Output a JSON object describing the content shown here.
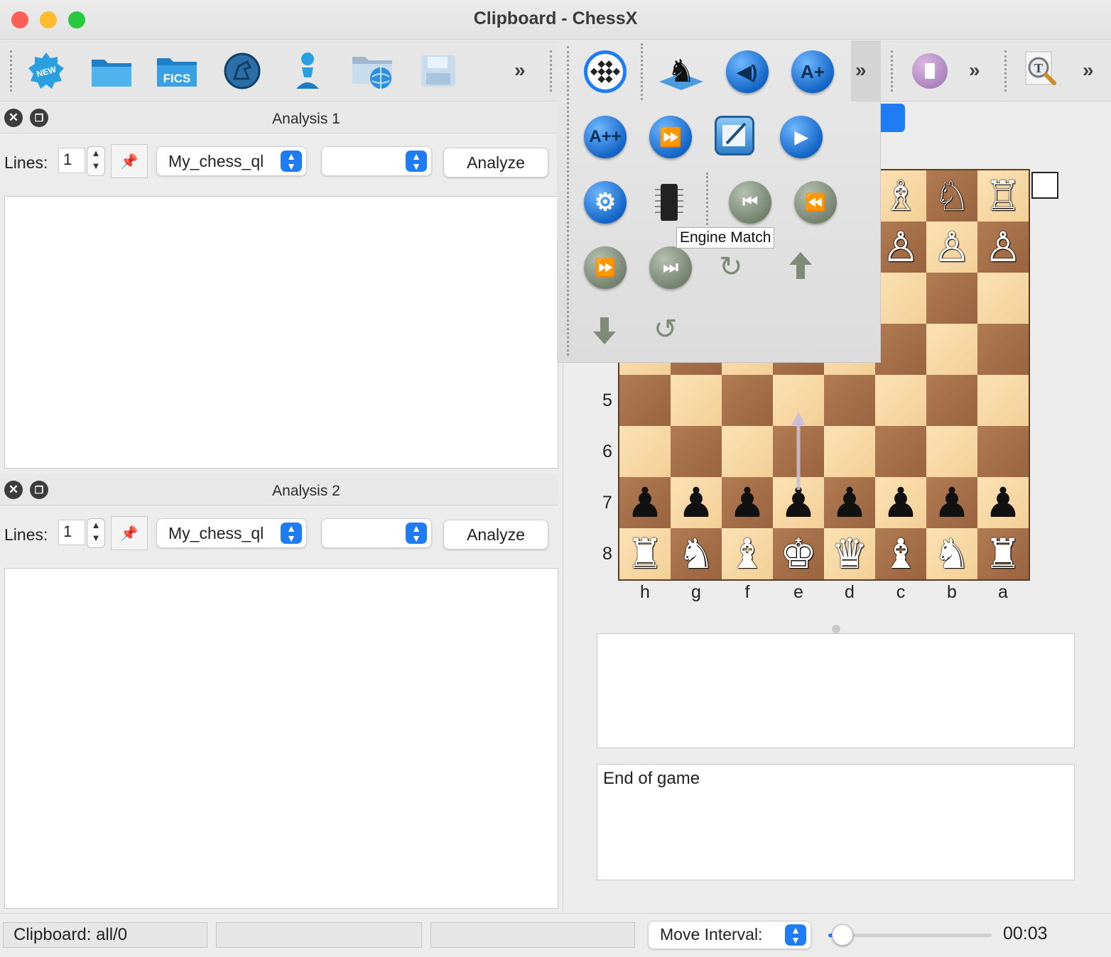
{
  "window": {
    "title": "Clipboard - ChessX"
  },
  "toolbar": {
    "icons": [
      "new-database-icon",
      "open-folder-icon",
      "fics-icon",
      "chess-knight-circle-icon",
      "pawn-icon",
      "web-folder-icon",
      "save-icon"
    ],
    "overflow": "»",
    "right_overflow_1": "»",
    "right_overflow_2": "»",
    "right_overflow_3": "»"
  },
  "analysis1": {
    "title": "Analysis 1",
    "lines_label": "Lines:",
    "lines_value": "1",
    "engine": "My_chess_ql",
    "second_select": "",
    "analyze": "Analyze"
  },
  "analysis2": {
    "title": "Analysis 2",
    "lines_label": "Lines:",
    "lines_value": "1",
    "engine": "My_chess_ql",
    "second_select": "",
    "analyze": "Analyze"
  },
  "popup_toolbar": {
    "aplus": "A+",
    "aplusplus": "A++",
    "tooltip": "Engine Match"
  },
  "board": {
    "ranks": [
      "5",
      "6",
      "7",
      "8"
    ],
    "files": [
      "h",
      "g",
      "f",
      "e",
      "d",
      "c",
      "b",
      "a"
    ],
    "top_visible_white": [
      "♗",
      "♘",
      "♖"
    ],
    "white_pawns_visible": [
      "♙",
      "♙",
      "♙"
    ],
    "rank7_black": [
      "♟",
      "♟",
      "♟",
      "♟",
      "♟",
      "♟",
      "♟",
      "♟"
    ],
    "rank8_black": [
      "♜",
      "♞",
      "♝",
      "♚",
      "♛",
      "♝",
      "♞",
      "♜"
    ]
  },
  "notes": {
    "game_text": "End of game"
  },
  "statusbar": {
    "clipboard": "Clipboard: all/0",
    "move_interval_label": "Move Interval:",
    "time": "00:03",
    "move_interval_level": 0.05
  },
  "colors": {
    "accent": "#1f7cf5",
    "light_square": "#f6d9a5",
    "dark_square": "#a46c46",
    "close": "#fe5f57",
    "minimize": "#febc2e",
    "maximize": "#28c840"
  }
}
